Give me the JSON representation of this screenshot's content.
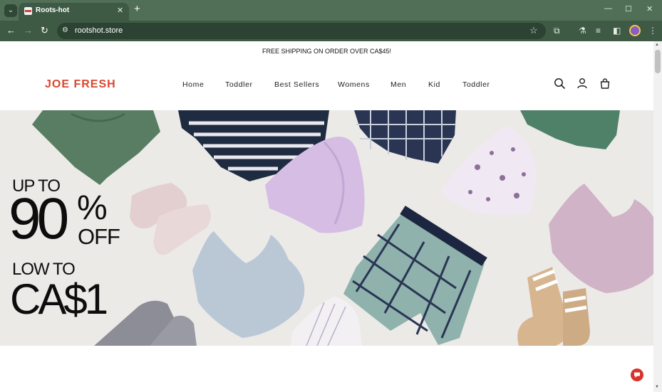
{
  "browser": {
    "tab_title": "Roots-hot",
    "url": "rootshot.store",
    "colors": {
      "frame": "#516e57",
      "toolbar": "#3e5a45",
      "omnibox": "#2c4333"
    }
  },
  "icons": {
    "tab_search": "chevron-down-icon",
    "tab_close": "close-icon",
    "new_tab": "plus-icon",
    "back": "arrow-left-icon",
    "forward": "arrow-right-icon",
    "reload": "reload-icon",
    "site_info": "tune-icon",
    "bookmark": "star-icon",
    "extensions": "puzzle-icon",
    "labs": "flask-icon",
    "media": "playlist-icon",
    "side_panel": "side-panel-icon",
    "menu": "kebab-menu-icon",
    "search": "search-icon",
    "account": "user-icon",
    "cart": "shopping-bag-icon",
    "chat": "chat-icon"
  },
  "announcement": "FREE SHIPPING ON ORDER OVER CA$45!",
  "header": {
    "logo": "JOE FRESH",
    "logo_color": "#d9472e",
    "nav": [
      "Home",
      "Toddler",
      "Best Sellers",
      "Womens",
      "Men",
      "Kid",
      "Toddler"
    ]
  },
  "hero": {
    "line1": "UP TO",
    "big_number": "90",
    "percent": "%",
    "off": "OFF",
    "line3": "LOW TO",
    "price": "CA$1"
  }
}
